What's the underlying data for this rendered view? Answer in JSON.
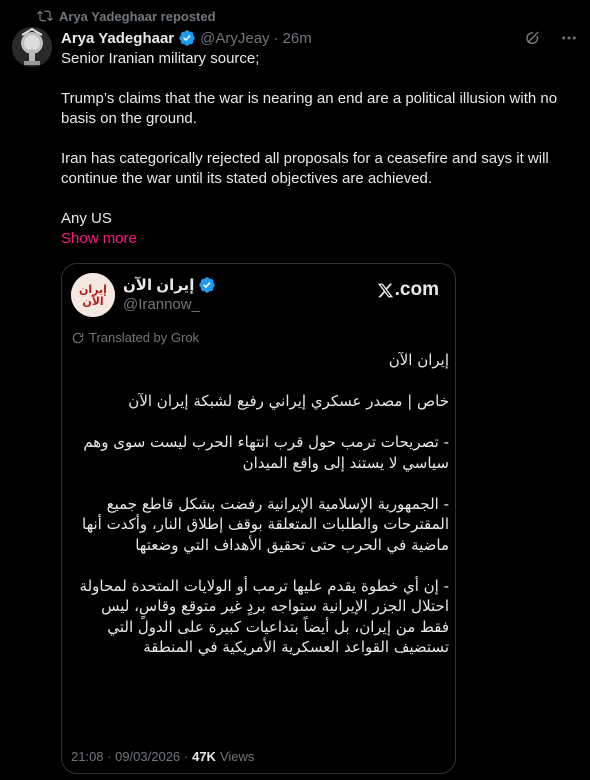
{
  "repost": {
    "label": "Arya Yadeghaar reposted"
  },
  "author": {
    "name": "Arya Yadeghaar",
    "handle": "@AryJeay",
    "separator": "·",
    "time": "26m"
  },
  "post": {
    "paragraphs": [
      "Senior Iranian military source;",
      "Trump’s claims that the war is nearing an end are a political illusion with no basis on the ground.",
      "Iran has categorically rejected all proposals for a ceasefire and says it will continue the war until its stated objectives are achieved.",
      "Any US"
    ],
    "show_more": "Show more"
  },
  "quote": {
    "name": "إيران الآن",
    "handle": "@Irannow_",
    "source_label": ".com",
    "translated_by": "Translated by Grok",
    "avatar_text": "إيران الآن",
    "paragraphs": [
      "إيران الآن",
      "خاص | مصدر عسكري إيراني رفيع لشبكة إيران الآن",
      "- تصريحات ترمب حول قرب انتهاء الحرب ليست سوى وهم سياسي لا يستند إلى واقع الميدان",
      "- الجمهورية الإسلامية الإيرانية رفضت بشكل قاطع جميع المقترحات والطلبات المتعلقة بوقف إطلاق النار، وأكدت أنها ماضية في الحرب حتى تحقيق الأهداف التي وضعتها",
      "- إن أي خطوة يقدم عليها ترمب أو الولايات المتحدة لمحاولة احتلال الجزر الإيرانية ستواجه بردٍ غير متوقع وقاسٍ، ليس فقط من إيران، بل أيضاً بتداعيات كبيرة على الدول التي تستضيف القواعد العسكرية الأمريكية في المنطقة"
    ],
    "timestamp": "21:08 · 09/03/2026 ·",
    "views_count": "47K",
    "views_label": "Views"
  },
  "colors": {
    "background": "#000000",
    "text": "#e7e9ea",
    "muted": "#71767b",
    "show_more": "#f91880",
    "verified": "#1d9bf0",
    "border": "#2f3336"
  },
  "icons": {
    "repost": "repost-icon",
    "verified": "verified-badge-icon",
    "grok": "grok-icon",
    "more": "more-dots-icon",
    "x_logo": "x-logo-icon"
  }
}
